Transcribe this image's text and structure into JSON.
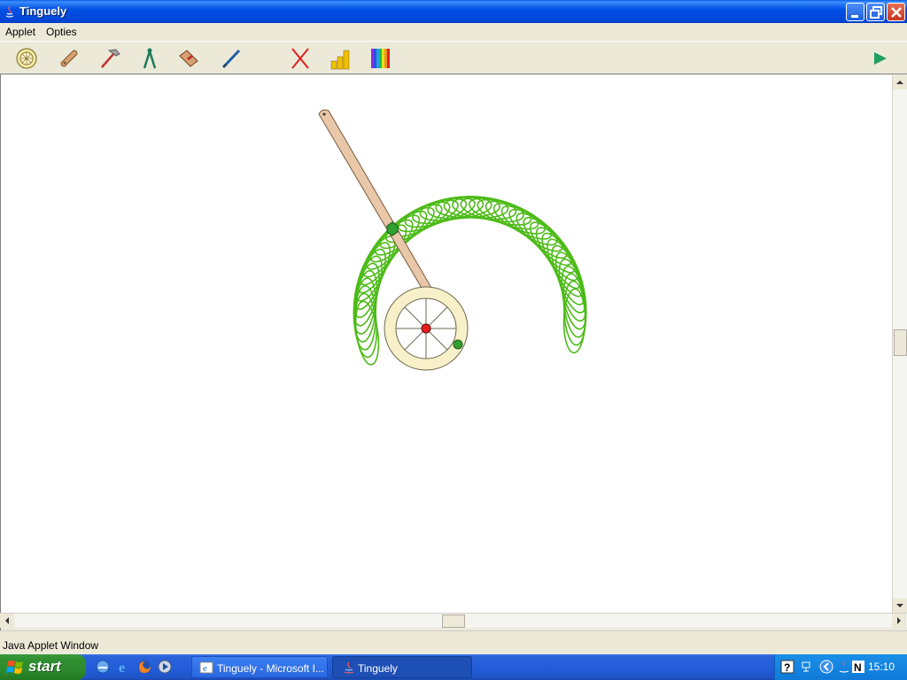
{
  "window": {
    "title": "Tinguely",
    "minimize_icon": "minimize-icon",
    "maximize_icon": "restore-icon",
    "close_icon": "close-icon"
  },
  "menu": {
    "items": [
      {
        "label": "Applet"
      },
      {
        "label": "Opties"
      }
    ]
  },
  "toolbar": {
    "tools": [
      {
        "icon": "wheel-icon"
      },
      {
        "icon": "bar-icon"
      },
      {
        "icon": "hammer-icon"
      },
      {
        "icon": "compass-icon"
      },
      {
        "icon": "eraser-icon"
      },
      {
        "icon": "pen-icon"
      },
      {
        "icon": "clear-icon"
      },
      {
        "icon": "chart-icon"
      },
      {
        "icon": "color-palette-icon"
      }
    ],
    "play_icon": "play-icon"
  },
  "colors": {
    "trace": "#4cbb17",
    "bar": "#e8c8a8",
    "wheel": "#f8f0c0",
    "pivot": "#e82020",
    "joint": "#30a030"
  },
  "status": {
    "text": "Java Applet Window"
  },
  "taskbar": {
    "start_label": "start",
    "tasks": [
      {
        "label": "Tinguely - Microsoft I...",
        "active": false
      },
      {
        "label": "Tinguely",
        "active": true
      }
    ],
    "clock": "15:10"
  }
}
